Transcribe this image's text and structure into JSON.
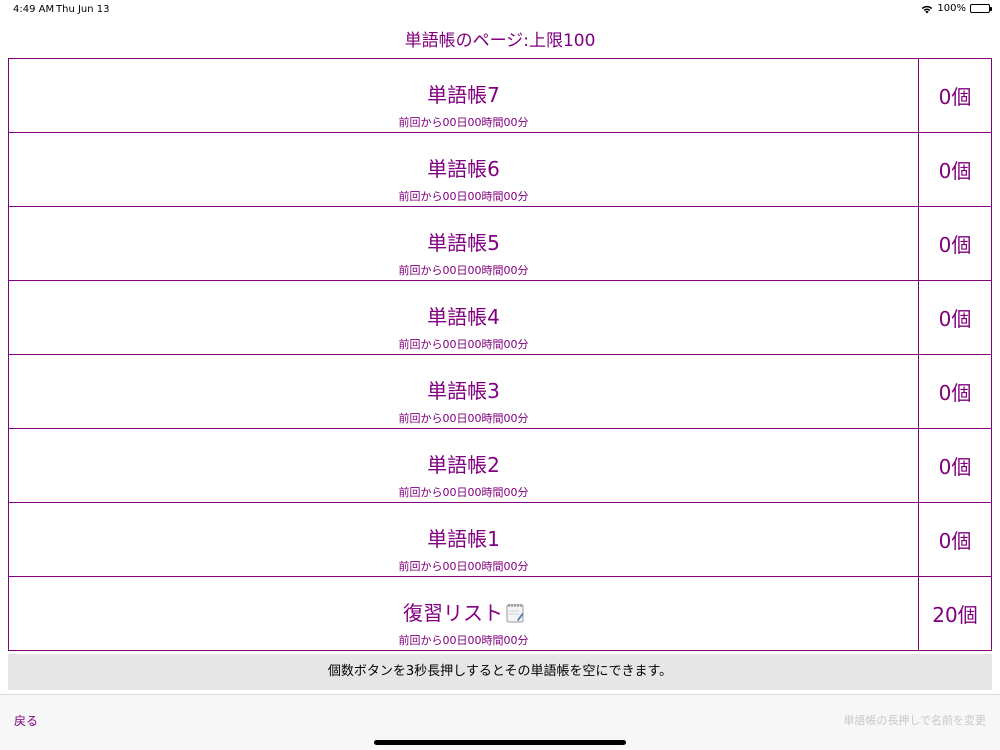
{
  "status_bar": {
    "time": "4:49 AM",
    "date": "Thu Jun 13",
    "battery": "100%"
  },
  "page_title": "単語帳のページ:上限100",
  "books": [
    {
      "name": "単語帳7",
      "since_last": "前回から00日00時間00分",
      "count": "0個"
    },
    {
      "name": "単語帳6",
      "since_last": "前回から00日00時間00分",
      "count": "0個"
    },
    {
      "name": "単語帳5",
      "since_last": "前回から00日00時間00分",
      "count": "0個"
    },
    {
      "name": "単語帳4",
      "since_last": "前回から00日00時間00分",
      "count": "0個"
    },
    {
      "name": "単語帳3",
      "since_last": "前回から00日00時間00分",
      "count": "0個"
    },
    {
      "name": "単語帳2",
      "since_last": "前回から00日00時間00分",
      "count": "0個"
    },
    {
      "name": "単語帳1",
      "since_last": "前回から00日00時間00分",
      "count": "0個"
    },
    {
      "name": "復習リスト",
      "since_last": "前回から00日00時間00分",
      "count": "20個",
      "icon": "memo-icon"
    }
  ],
  "hint": "個数ボタンを3秒長押しするとその単語帳を空にできます。",
  "toolbar": {
    "back_label": "戻る",
    "rename_hint": "単語帳の長押しで名前を変更"
  },
  "colors": {
    "accent": "#800080",
    "banner_bg": "#e6e6e6",
    "disabled_text": "#c8c8c8"
  }
}
